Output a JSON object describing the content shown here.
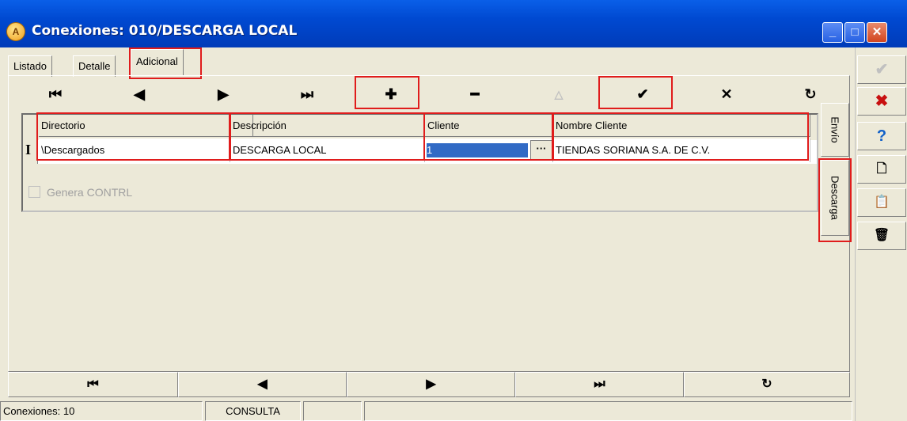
{
  "window": {
    "title": "Conexiones: 010/DESCARGA LOCAL",
    "logo_letter": "A",
    "controls": {
      "minimize": "_",
      "maximize": "□",
      "close": "✕"
    }
  },
  "tabs": [
    {
      "label": "Listado"
    },
    {
      "label": "Detalle"
    },
    {
      "label": "Adicional"
    }
  ],
  "navigator": {
    "first": "⏮",
    "prior": "◀",
    "next": "▶",
    "last": "⏭",
    "insert": "✚",
    "delete": "━",
    "edit": "△",
    "post": "✔",
    "cancel": "✕",
    "refresh": "↻"
  },
  "grid": {
    "columns": [
      "Directorio",
      "Descripción",
      "Cliente",
      "Nombre Cliente"
    ],
    "rows": [
      {
        "indicator": "I",
        "directorio": "\\Descargados",
        "descripcion": "DESCARGA LOCAL",
        "cliente": "1",
        "nombre_cliente": "TIENDAS SORIANA S.A. DE C.V."
      }
    ],
    "ellipsis": "···"
  },
  "checkbox": {
    "label": "Genera CONTRL",
    "checked": false
  },
  "side_tabs": [
    {
      "label": "Envío"
    },
    {
      "label": "Descarga"
    }
  ],
  "bottom_nav": {
    "first": "⏮",
    "prior": "◀",
    "next": "▶",
    "last": "⏭",
    "refresh": "↻"
  },
  "status": {
    "count": "Conexiones: 10",
    "mode": "CONSULTA"
  },
  "sidebar": {
    "accept_icon": "✔",
    "close_icon": "✖",
    "help_icon": "?",
    "new_icon": "🗋",
    "copy_icon": "📋",
    "delete_icon": "🗑"
  },
  "colors": {
    "title_bar": "#0049d1",
    "highlight": "#e01c1c",
    "selection": "#316ac5",
    "face": "#ece9d8"
  }
}
